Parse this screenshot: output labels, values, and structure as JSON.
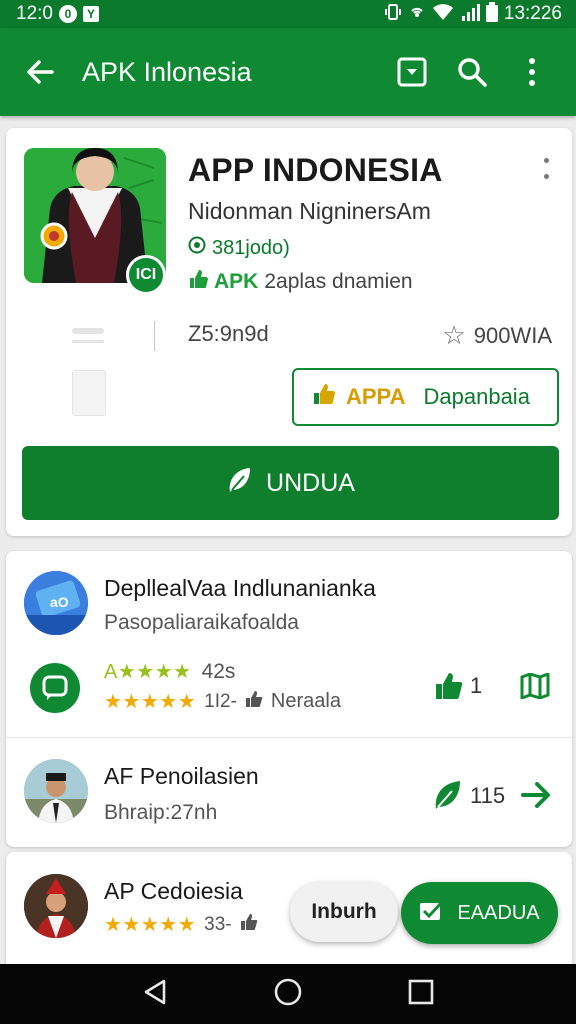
{
  "status_bar": {
    "time_left": "12:0",
    "badge_1": "0",
    "badge_2": "Y",
    "time_right": "13:226"
  },
  "app_bar": {
    "title": "APK Inlonesia",
    "icons": [
      "back-arrow-icon",
      "install-box-icon",
      "search-icon",
      "more-vert-icon"
    ]
  },
  "app": {
    "title": "APP INDONESIA",
    "developer": "Nidonman NigninersAm",
    "meta_1": "381jodo)",
    "meta_2_tag": "APK",
    "meta_2_text": "2aplas dnamien",
    "icon_badge": "ICI",
    "size": "Z5:9n9d",
    "rating": "900WIA",
    "outline_button": {
      "label_a": "APPA",
      "label_b": "Dapanbaia"
    },
    "install_label": "UNDUA"
  },
  "list": [
    {
      "title": "DepllealVaa Indlunanianka",
      "subtitle": "Pasopaliaraikafoalda",
      "stars_1": "A★★★★",
      "rating_1": "42s",
      "stars_2": "★★★★★",
      "rating_2": "1I2-",
      "extra": "Neraala",
      "count": "1"
    },
    {
      "title": "AF Penoilasien",
      "subtitle": "Bhraip:27nh",
      "count": "115"
    },
    {
      "title": "AP Cedoiesia",
      "stars": "★★★★★",
      "rating": "33-"
    }
  ],
  "fabs": {
    "light_label": "Inburh",
    "green_label": "EAADUA"
  },
  "colors": {
    "primary": "#0f8a33",
    "primary_dark": "#0b7a2c",
    "star": "#f2a900",
    "accent_amber": "#d89b00"
  }
}
